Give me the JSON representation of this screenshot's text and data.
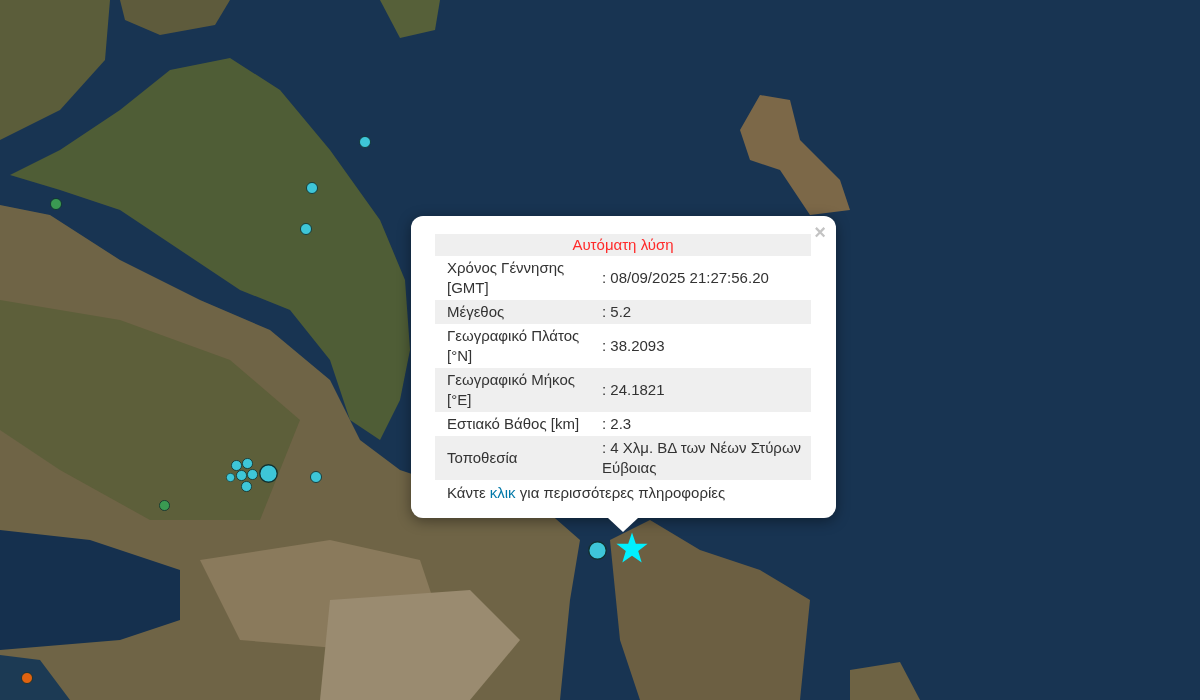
{
  "map": {
    "markers": [
      {
        "kind": "circle",
        "color": "#3ec6d8"
      },
      {
        "kind": "circle",
        "color": "#3ec6d8"
      },
      {
        "kind": "circle",
        "color": "#3ec6d8"
      },
      {
        "kind": "circle",
        "color": "#3a9a52"
      },
      {
        "kind": "circle",
        "color": "#3ec6d8"
      },
      {
        "kind": "circle",
        "color": "#3ec6d8"
      },
      {
        "kind": "circle",
        "color": "#3ec6d8"
      },
      {
        "kind": "circle",
        "color": "#3ec6d8"
      },
      {
        "kind": "circle",
        "color": "#3ec6d8"
      },
      {
        "kind": "circle",
        "color": "#3ec6d8"
      },
      {
        "kind": "circle",
        "color": "#3ec6d8"
      },
      {
        "kind": "circle",
        "color": "#3ec6d8"
      },
      {
        "kind": "circle",
        "color": "#3a9a52"
      },
      {
        "kind": "circle",
        "color": "#3ec6d8"
      },
      {
        "kind": "star",
        "color": "#00f0ff"
      },
      {
        "kind": "circle",
        "color": "#e0620f"
      }
    ]
  },
  "popup": {
    "close": "×",
    "title": "Αυτόματη λύση",
    "rows": [
      {
        "label": "Χρόνος Γέννησης [GMT]",
        "value": ": 08/09/2025 21:27:56.20"
      },
      {
        "label": "Μέγεθος",
        "value": ": 5.2"
      },
      {
        "label": "Γεωγραφικό Πλάτος [°N]",
        "value": ": 38.2093"
      },
      {
        "label": "Γεωγραφικό Μήκος [°E]",
        "value": ": 24.1821"
      },
      {
        "label": "Εστιακό Βάθος [km]",
        "value": ": 2.3"
      },
      {
        "label": "Τοποθεσία",
        "value": ": 4 Χλμ. ΒΔ των Νέων Στύρων Εύβοιας"
      }
    ],
    "footer": {
      "before": "Κάντε",
      "link": "κλικ",
      "after": "για περισσότερες πληροφορίες"
    }
  }
}
